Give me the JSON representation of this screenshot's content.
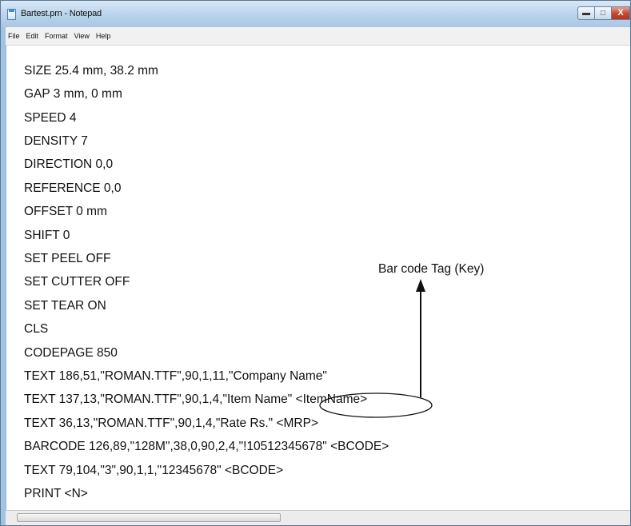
{
  "window": {
    "title": "Bartest.prn - Notepad",
    "icon": "notepad-icon",
    "controls": [
      "minimize-icon",
      "maximize-icon",
      "close-icon"
    ],
    "close_label": "X"
  },
  "menu": {
    "items": [
      {
        "label": "File"
      },
      {
        "label": "Edit"
      },
      {
        "label": "Format"
      },
      {
        "label": "View"
      },
      {
        "label": "Help"
      }
    ]
  },
  "editor": {
    "lines": [
      "SIZE 25.4 mm, 38.2 mm",
      "GAP 3 mm, 0 mm",
      "SPEED 4",
      "DENSITY 7",
      "DIRECTION 0,0",
      "REFERENCE 0,0",
      "OFFSET 0 mm",
      "SHIFT 0",
      "SET PEEL OFF",
      "SET CUTTER OFF",
      "SET TEAR ON",
      "CLS",
      "CODEPAGE 850",
      "TEXT 186,51,\"ROMAN.TTF\",90,1,11,\"Company Name\"",
      "TEXT 137,13,\"ROMAN.TTF\",90,1,4,\"Item Name\" <ItemName>",
      "TEXT 36,13,\"ROMAN.TTF\",90,1,4,\"Rate Rs.\" <MRP>",
      "BARCODE 126,89,\"128M\",38,0,90,2,4,\"!10512345678\" <BCODE>",
      "TEXT 79,104,\"3\",90,1,1,\"12345678\" <BCODE>",
      "PRINT <N>"
    ]
  },
  "annotation": {
    "label": "Bar code Tag (Key)"
  },
  "colors": {
    "titlebar": "#b9d3ec",
    "close_button": "#c7432b",
    "text": "#111111"
  }
}
